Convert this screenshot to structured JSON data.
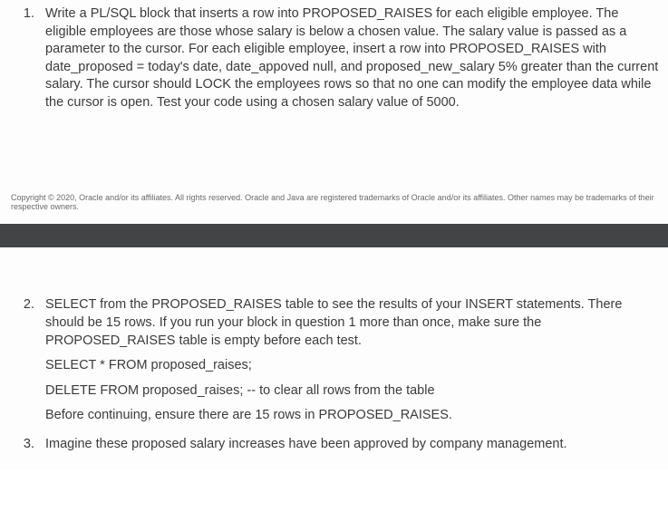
{
  "page1": {
    "q1_text": "Write a PL/SQL block that inserts a row into PROPOSED_RAISES for each eligible employee. The eligible employees are those whose salary is below a chosen value. The salary value is passed as a parameter to the cursor. For each eligible employee, insert a row into PROPOSED_RAISES with date_proposed = today's date, date_appoved null, and proposed_new_salary 5% greater than the current salary. The cursor should LOCK the employees rows so that no one can modify the employee data while the cursor is open. Test your code using a chosen salary value of 5000.",
    "copyright": "Copyright © 2020, Oracle and/or its affiliates. All rights reserved. Oracle and Java are registered trademarks of Oracle and/or its affiliates. Other names may be trademarks of their respective owners."
  },
  "page2": {
    "q2_text": "SELECT from the PROPOSED_RAISES table to see the results of your INSERT statements. There should be 15 rows. If you run your block in question 1 more than once, make sure the PROPOSED_RAISES table is empty before each test.",
    "q2_code1": "SELECT * FROM proposed_raises;",
    "q2_code2": "DELETE FROM proposed_raises; -- to clear all rows from the table",
    "q2_note": "Before continuing, ensure there are 15 rows in PROPOSED_RAISES.",
    "q3_text": "Imagine these proposed salary increases have been approved by company management."
  }
}
